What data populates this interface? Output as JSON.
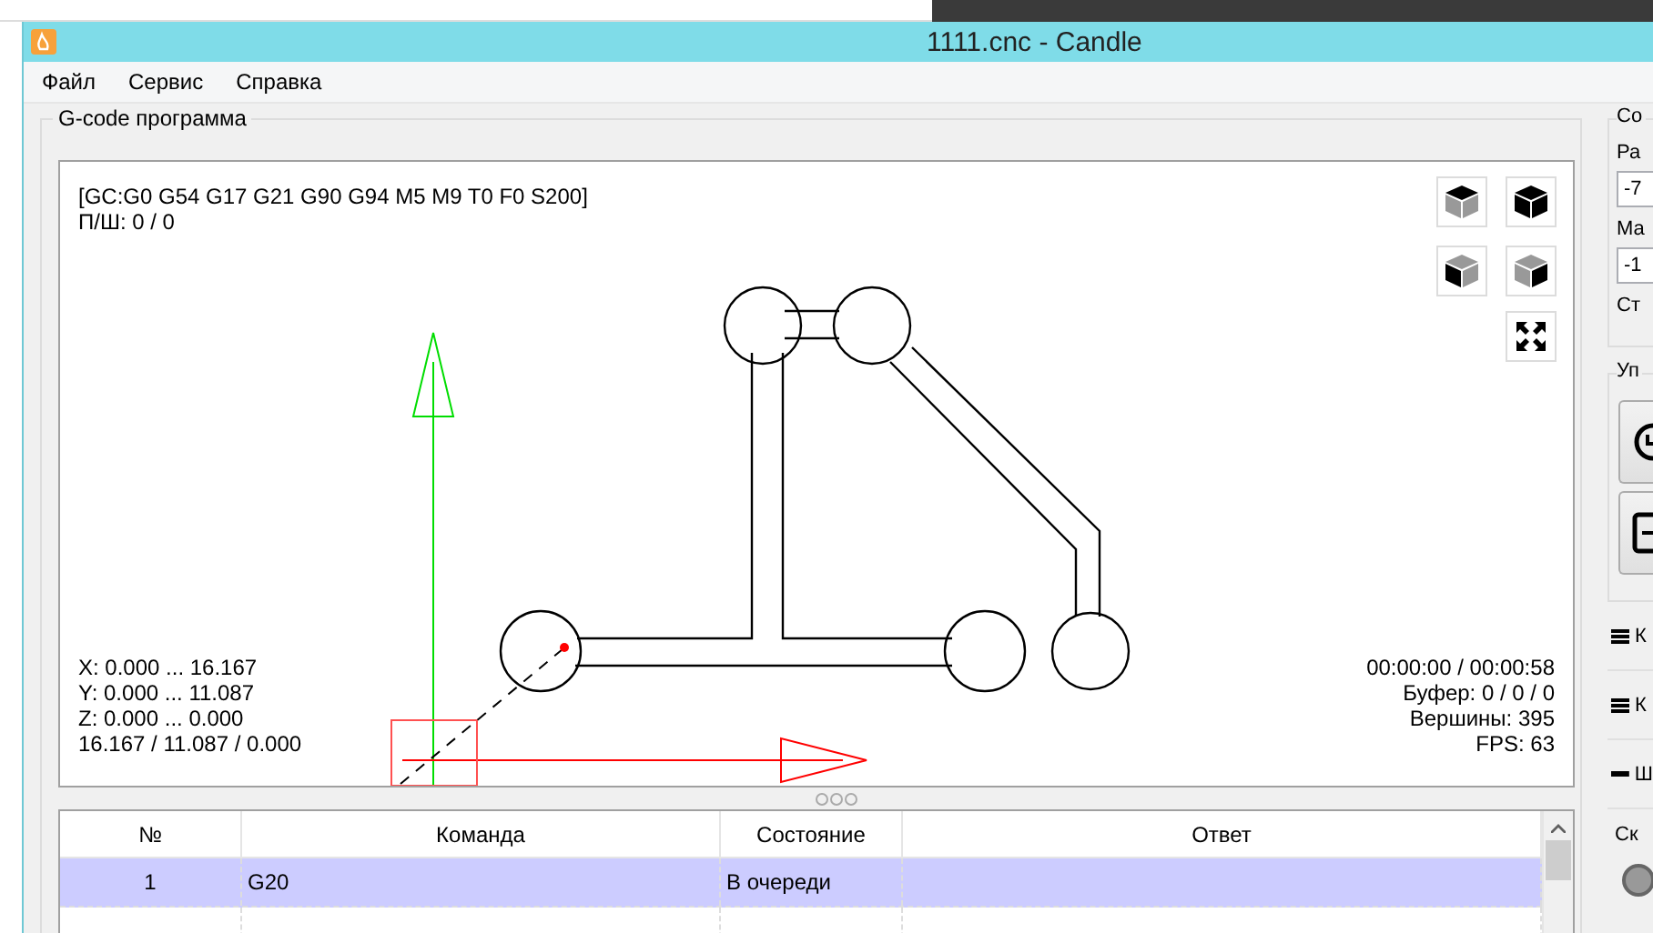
{
  "window": {
    "title": "1111.cnc - Candle"
  },
  "menu": [
    {
      "label": "Файл"
    },
    {
      "label": "Сервис"
    },
    {
      "label": "Справка"
    }
  ],
  "gcode_panel": {
    "title": "G-code программа",
    "viewer": {
      "status_lines": [
        "[GC:G0 G54 G17 G21 G90 G94 M5 M9 T0 F0 S200]",
        "П/Ш: 0 / 0"
      ],
      "bounds_lines": [
        "X: 0.000 ... 16.167",
        "Y: 0.000 ... 11.087",
        "Z: 0.000 ... 0.000",
        "16.167 / 11.087 / 0.000"
      ],
      "stats_lines": [
        "00:00:00 / 00:00:58",
        "Буфер: 0 / 0 / 0",
        "Вершины: 395",
        "FPS: 63"
      ]
    },
    "table": {
      "columns": [
        "№",
        "Команда",
        "Состояние",
        "Ответ"
      ],
      "rows": [
        {
          "number": "1",
          "command": "G20",
          "state": "В очереди",
          "selected": true
        },
        {
          "selected": false
        }
      ]
    }
  },
  "right_panel": {
    "state_group": {
      "title": "Со",
      "work_label": "Ра",
      "work_value": "-7",
      "machine_label": "Ма",
      "machine_value": "-1",
      "status_label": "Ст"
    },
    "control_group": {
      "title": "Уп"
    },
    "sections": [
      {
        "title": "К",
        "expanded": false
      },
      {
        "title": "К",
        "expanded": false
      },
      {
        "title": "Ш",
        "expanded": true
      }
    ],
    "speed_label": "Ск"
  }
}
